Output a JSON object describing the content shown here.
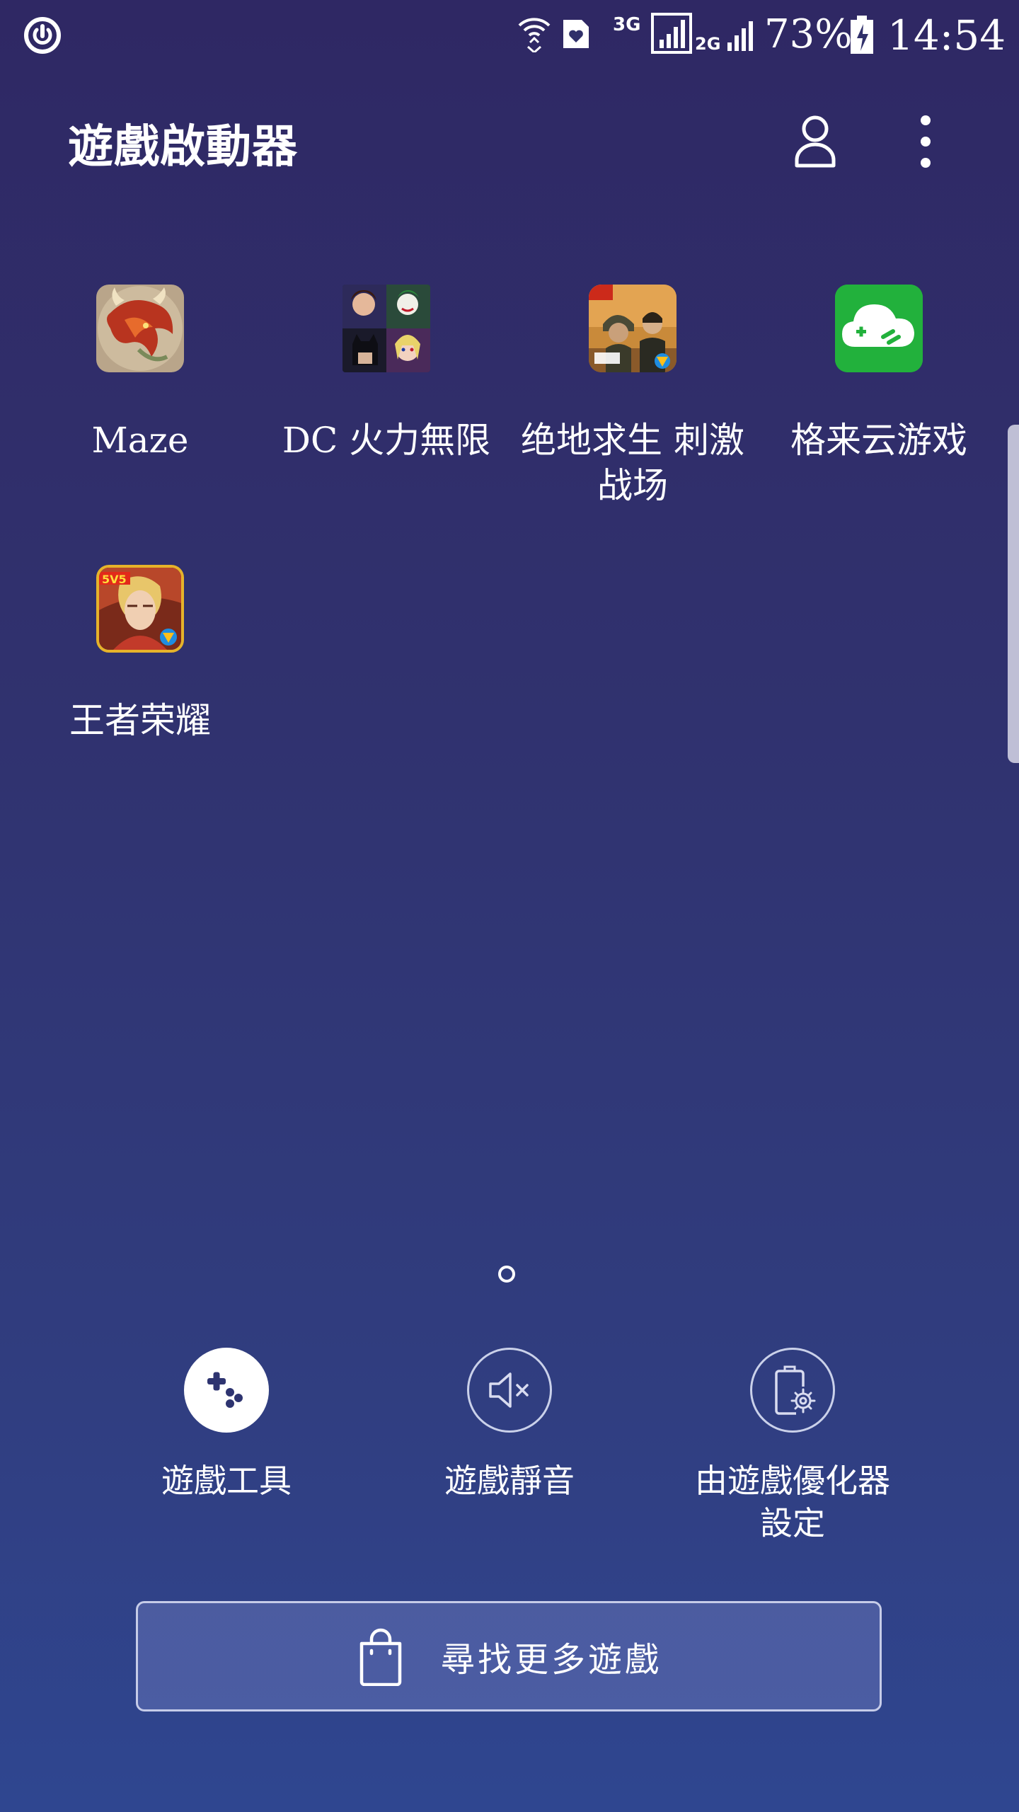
{
  "status_bar": {
    "network_type": "3G",
    "secondary_network": "2G",
    "battery": "73%",
    "time": "14:54"
  },
  "header": {
    "title": "遊戲啟動器",
    "profile_icon": "person-icon",
    "menu_icon": "more-vertical-icon"
  },
  "games": [
    {
      "label": "Maze",
      "icon": "maze-dragon-icon"
    },
    {
      "label": "DC 火力無限",
      "icon": "dc-heroes-icon"
    },
    {
      "label": "绝地求生 刺激战场",
      "icon": "pubg-icon"
    },
    {
      "label": "格来云游戏",
      "icon": "cloud-gamepad-icon"
    },
    {
      "label": "王者荣耀",
      "icon": "honor-of-kings-icon"
    }
  ],
  "tools": [
    {
      "label": "遊戲工具",
      "icon": "gamepad-icon"
    },
    {
      "label": "遊戲靜音",
      "icon": "mute-icon"
    },
    {
      "label": "由遊戲優化器設定",
      "icon": "battery-settings-icon"
    }
  ],
  "find_more": {
    "label": "尋找更多遊戲",
    "icon": "shopping-bag-icon"
  },
  "colors": {
    "background_top": "#2f2864",
    "background_bottom": "#2f4690",
    "cloud_game_green": "#22b13c"
  }
}
